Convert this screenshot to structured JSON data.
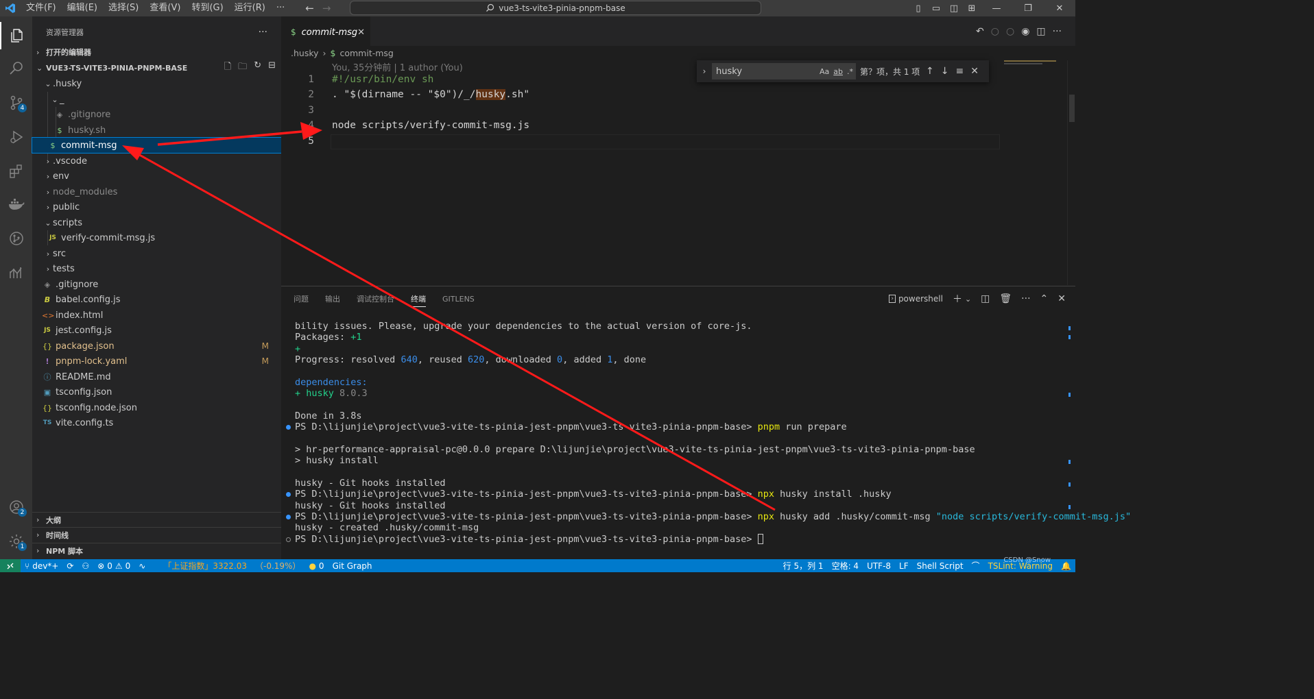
{
  "titlebar": {
    "menu": [
      "文件(F)",
      "编辑(E)",
      "选择(S)",
      "查看(V)",
      "转到(G)",
      "运行(R)",
      "···"
    ],
    "search_text": "vue3-ts-vite3-pinia-pnpm-base"
  },
  "activity": {
    "scm_badge": "4",
    "accounts_badge": "2",
    "settings_badge": "1"
  },
  "sidebar": {
    "header": "资源管理器",
    "open_editors": "打开的编辑器",
    "project": "VUE3-TS-VITE3-PINIA-PNPM-BASE",
    "tree": [
      {
        "label": ".husky"
      },
      {
        "label": "_"
      },
      {
        "label": ".gitignore"
      },
      {
        "label": "husky.sh"
      },
      {
        "label": "commit-msg"
      },
      {
        "label": ".vscode"
      },
      {
        "label": "env"
      },
      {
        "label": "node_modules"
      },
      {
        "label": "public"
      },
      {
        "label": "scripts"
      },
      {
        "label": "verify-commit-msg.js"
      },
      {
        "label": "src"
      },
      {
        "label": "tests"
      },
      {
        "label": ".gitignore"
      },
      {
        "label": "babel.config.js"
      },
      {
        "label": "index.html"
      },
      {
        "label": "jest.config.js"
      },
      {
        "label": "package.json",
        "badge": "M"
      },
      {
        "label": "pnpm-lock.yaml",
        "badge": "M"
      },
      {
        "label": "README.md"
      },
      {
        "label": "tsconfig.json"
      },
      {
        "label": "tsconfig.node.json"
      },
      {
        "label": "vite.config.ts"
      }
    ],
    "outline": "大纲",
    "timeline": "时间线",
    "npm": "NPM 脚本"
  },
  "editor": {
    "tab_label": "commit-msg",
    "breadcrumb": [
      ".husky",
      "commit-msg"
    ],
    "blame": "You, 35分钟前 | 1 author (You)",
    "line_numbers": [
      "1",
      "2",
      "3",
      "4",
      "5"
    ],
    "line1": "#!/usr/bin/env sh",
    "line2_a": ". \"$(dirname -- \"$0\")/_/",
    "line2_hl": "husky",
    "line2_b": ".sh\"",
    "line4": "node scripts/verify-commit-msg.js",
    "find": {
      "value": "husky",
      "opt_case": "Aa",
      "opt_word": "ab",
      "opt_regex": ".*",
      "count": "第？项，共 1 项"
    }
  },
  "panel": {
    "tabs": [
      "问题",
      "输出",
      "调试控制台",
      "终端",
      "GITLENS"
    ],
    "shell": "powershell",
    "terminal": {
      "l1": "bility issues. Please, upgrade your dependencies to the actual version of core-js.",
      "l2_a": "Packages: ",
      "l2_b": "+1",
      "l3": "+",
      "l4_a": "Progress: resolved ",
      "l4_n1": "640",
      "l4_b": ", reused ",
      "l4_n2": "620",
      "l4_c": ", downloaded ",
      "l4_n3": "0",
      "l4_d": ", added ",
      "l4_n4": "1",
      "l4_e": ", done",
      "l6": "dependencies:",
      "l7_a": "+ husky ",
      "l7_b": "8.0.3",
      "l9": "Done in 3.8s",
      "prompt": "PS D:\\lijunjie\\project\\vue3-vite-ts-pinia-jest-pnpm\\vue3-ts-vite3-pinia-pnpm-base> ",
      "cmd1_a": "pnpm",
      "cmd1_b": " run prepare",
      "l12": "> hr-performance-appraisal-pc@0.0.0 prepare D:\\lijunjie\\project\\vue3-vite-ts-pinia-jest-pnpm\\vue3-ts-vite3-pinia-pnpm-base",
      "l13": "> husky install",
      "l15": "husky - Git hooks installed",
      "cmd2_a": "npx",
      "cmd2_b": " husky install .husky",
      "l17": "husky - Git hooks installed",
      "cmd3_a": "npx",
      "cmd3_b": " husky add .husky/commit-msg ",
      "cmd3_c": "\"node scripts/verify-commit-msg.js\"",
      "l19": "husky - created .husky/commit-msg"
    }
  },
  "status": {
    "branch": "dev*+",
    "errors": "0",
    "warnings": "0",
    "stock_name": "「上证指数」3322.03",
    "stock_pct": "（-0.19%）",
    "bell_count": "0",
    "git_graph": "Git Graph",
    "position": "行 5，列 1",
    "spaces": "空格: 4",
    "encoding": "UTF-8",
    "eol": "LF",
    "language": "Shell Script",
    "tslint": "TSLint: Warning",
    "watermark": "CSDN @Snow"
  },
  "colors": {
    "accent": "#007acc",
    "arrow": "#ff1a1a",
    "selection": "#04395e"
  }
}
